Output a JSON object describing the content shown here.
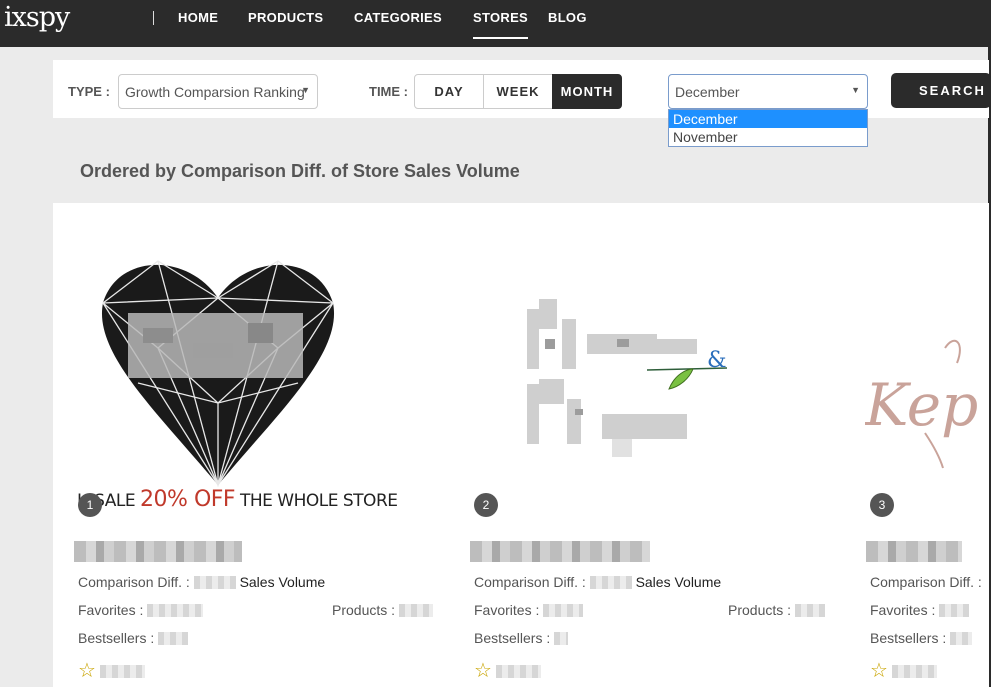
{
  "nav": {
    "logo": "ixspy",
    "items": [
      "HOME",
      "PRODUCTS",
      "CATEGORIES",
      "STORES",
      "BLOG"
    ],
    "active": "STORES"
  },
  "filters": {
    "type_label": "TYPE :",
    "type_value": "Growth Comparsion Ranking",
    "time_label": "TIME :",
    "time_options": [
      "DAY",
      "WEEK",
      "MONTH"
    ],
    "time_selected": "MONTH",
    "month_value": "December",
    "month_options": [
      "December",
      "November"
    ],
    "month_highlighted": "December",
    "search_label": "SEARCH"
  },
  "section_title": "Ordered by Comparison Diff. of Store Sales Volume",
  "cards": [
    {
      "rank": "1",
      "banner_text_dark1": "H SALE",
      "banner_text_red": "20% OFF",
      "banner_text_dark2": "THE WHOLE STORE",
      "diff_label": "Comparison Diff. :",
      "diff_suffix": "Sales Volume",
      "favorites_label": "Favorites :",
      "products_label": "Products :",
      "bestsellers_label": "Bestsellers :"
    },
    {
      "rank": "2",
      "diff_label": "Comparison Diff. :",
      "diff_suffix": "Sales Volume",
      "favorites_label": "Favorites :",
      "products_label": "Products :",
      "bestsellers_label": "Bestsellers :"
    },
    {
      "rank": "3",
      "logo_text": "Kep",
      "diff_label": "Comparison Diff. :",
      "favorites_label": "Favorites :",
      "bestsellers_label": "Bestsellers :"
    }
  ],
  "colors": {
    "nav_bg": "#2b2b2b",
    "accent_red": "#c0392b",
    "dropdown_highlight": "#1e90ff",
    "star": "#c9a400"
  },
  "icons": [
    "star-outline-icon",
    "caret-down-icon"
  ]
}
